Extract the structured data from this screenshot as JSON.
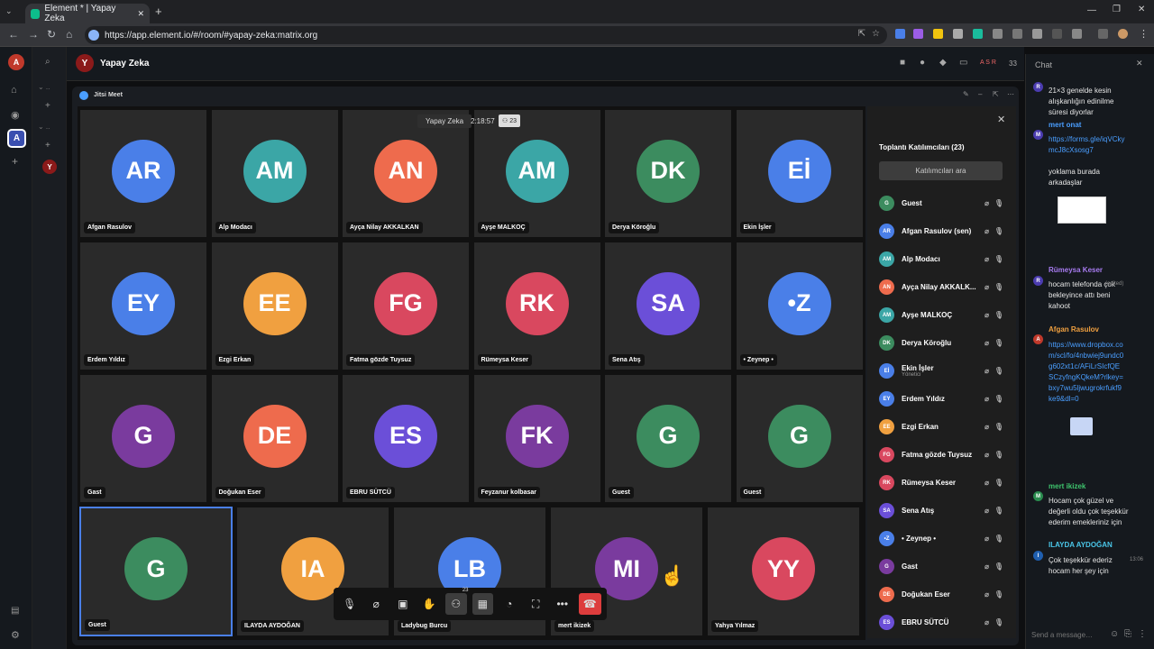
{
  "browser": {
    "tab_title": "Element * | Yapay Zeka",
    "url": "https://app.element.io/#/room/#yapay-zeka:matrix.org"
  },
  "room": {
    "name": "Yapay Zeka",
    "initial": "Y",
    "member_count": "33",
    "header_avatars": "A S R"
  },
  "widget": {
    "title": "Jitsi Meet",
    "overlay_room": "Yapay Zeka",
    "timer": "2:18:57",
    "count": "23"
  },
  "tiles": [
    {
      "initials": "AR",
      "name": "Afgan Rasulov",
      "color": "#4a7fe8"
    },
    {
      "initials": "AM",
      "name": "Alp Modacı",
      "color": "#3ba6a6"
    },
    {
      "initials": "AN",
      "name": "Ayça Nilay AKKALKAN",
      "color": "#ee6b4d"
    },
    {
      "initials": "AM",
      "name": "Ayşe MALKOÇ",
      "color": "#3ba6a6"
    },
    {
      "initials": "DK",
      "name": "Derya Köroğlu",
      "color": "#3c8c5f"
    },
    {
      "initials": "Eİ",
      "name": "Ekin İşler",
      "color": "#4a7fe8"
    },
    {
      "initials": "EY",
      "name": "Erdem Yıldız",
      "color": "#4a7fe8"
    },
    {
      "initials": "EE",
      "name": "Ezgi Erkan",
      "color": "#f0a040"
    },
    {
      "initials": "FG",
      "name": "Fatma gözde Tuysuz",
      "color": "#d9485f"
    },
    {
      "initials": "RK",
      "name": "Rümeysa Keser",
      "color": "#d9485f"
    },
    {
      "initials": "SA",
      "name": "Sena Atış",
      "color": "#6b4fd8"
    },
    {
      "initials": "•Z",
      "name": "• Zeynep •",
      "color": "#4a7fe8"
    },
    {
      "initials": "G",
      "name": "Gast",
      "color": "#7a3b9e"
    },
    {
      "initials": "DE",
      "name": "Doğukan Eser",
      "color": "#ee6b4d"
    },
    {
      "initials": "ES",
      "name": "EBRU SÜTCÜ",
      "color": "#6b4fd8"
    },
    {
      "initials": "FK",
      "name": "Feyzanur kolbasar",
      "color": "#7a3b9e"
    },
    {
      "initials": "G",
      "name": "Guest",
      "color": "#3c8c5f"
    },
    {
      "initials": "G",
      "name": "Guest",
      "color": "#3c8c5f"
    },
    {
      "initials": "G",
      "name": "Guest",
      "color": "#3c8c5f"
    },
    {
      "initials": "IA",
      "name": "ILAYDA AYDOĞAN",
      "color": "#f0a040"
    },
    {
      "initials": "LB",
      "name": "Ladybug Burcu",
      "color": "#4a7fe8"
    },
    {
      "initials": "MI",
      "name": "mert ikizek",
      "color": "#7a3b9e"
    },
    {
      "initials": "YY",
      "name": "Yahya Yılmaz",
      "color": "#d9485f"
    }
  ],
  "participants": {
    "title": "Toplantı Katılımcıları (23)",
    "search_label": "Katılımcıları ara",
    "people": [
      {
        "initials": "G",
        "name": "Guest",
        "color": "#3c8c5f"
      },
      {
        "initials": "AR",
        "name": "Afgan Rasulov (sen)",
        "color": "#4a7fe8"
      },
      {
        "initials": "AM",
        "name": "Alp Modacı",
        "color": "#3ba6a6"
      },
      {
        "initials": "AN",
        "name": "Ayça Nilay AKKALK...",
        "color": "#ee6b4d"
      },
      {
        "initials": "AM",
        "name": "Ayşe MALKOÇ",
        "color": "#3ba6a6"
      },
      {
        "initials": "DK",
        "name": "Derya Köroğlu",
        "color": "#3c8c5f"
      },
      {
        "initials": "Eİ",
        "name": "Ekin İşler",
        "color": "#4a7fe8",
        "sub": "Yönetici"
      },
      {
        "initials": "EY",
        "name": "Erdem Yıldız",
        "color": "#4a7fe8"
      },
      {
        "initials": "EE",
        "name": "Ezgi Erkan",
        "color": "#f0a040"
      },
      {
        "initials": "FG",
        "name": "Fatma gözde Tuysuz",
        "color": "#d9485f"
      },
      {
        "initials": "RK",
        "name": "Rümeysa Keser",
        "color": "#d9485f"
      },
      {
        "initials": "SA",
        "name": "Sena Atış",
        "color": "#6b4fd8"
      },
      {
        "initials": "•Z",
        "name": "• Zeynep •",
        "color": "#4a7fe8"
      },
      {
        "initials": "G",
        "name": "Gast",
        "color": "#7a3b9e"
      },
      {
        "initials": "DE",
        "name": "Doğukan Eser",
        "color": "#ee6b4d"
      },
      {
        "initials": "ES",
        "name": "EBRU SÜTCÜ",
        "color": "#6b4fd8"
      }
    ]
  },
  "toolbar": {
    "participant_count": "23"
  },
  "chat": {
    "title": "Chat",
    "composer_placeholder": "Send a message…",
    "m1": "21×3 genelde kesin alışkanlığın edinilme süresi diyorlar",
    "sender_mert": "mert onat",
    "link1": "https://forms.gle/iqVCkymcJ8cXsosg7",
    "m2": "yoklama burada arkadaşlar",
    "sender_rumeysa": "Rümeysa Keser",
    "m3": "hocam telefonda çok bekleyince attı beni kahoot",
    "edited": "(edited)",
    "sender_afgan": "Afgan Rasulov",
    "link2": "https://www.dropbox.com/scl/fo/4nbwiej9undc0g602xt1c/AFiLrSIcfQESCzyfngKQkeM?rlkey=bxy7wu5ljwugrokrfukf9ke9&dl=0",
    "sender_mertik": "mert ikizek",
    "m4": "Hocam çok güzel ve değerli oldu çok teşekkür ederim emekleriniz için",
    "sender_ilayda": "ILAYDA AYDOĞAN",
    "m5": "Çok teşekkür ederiz hocam her şey için",
    "time": "13:06"
  }
}
